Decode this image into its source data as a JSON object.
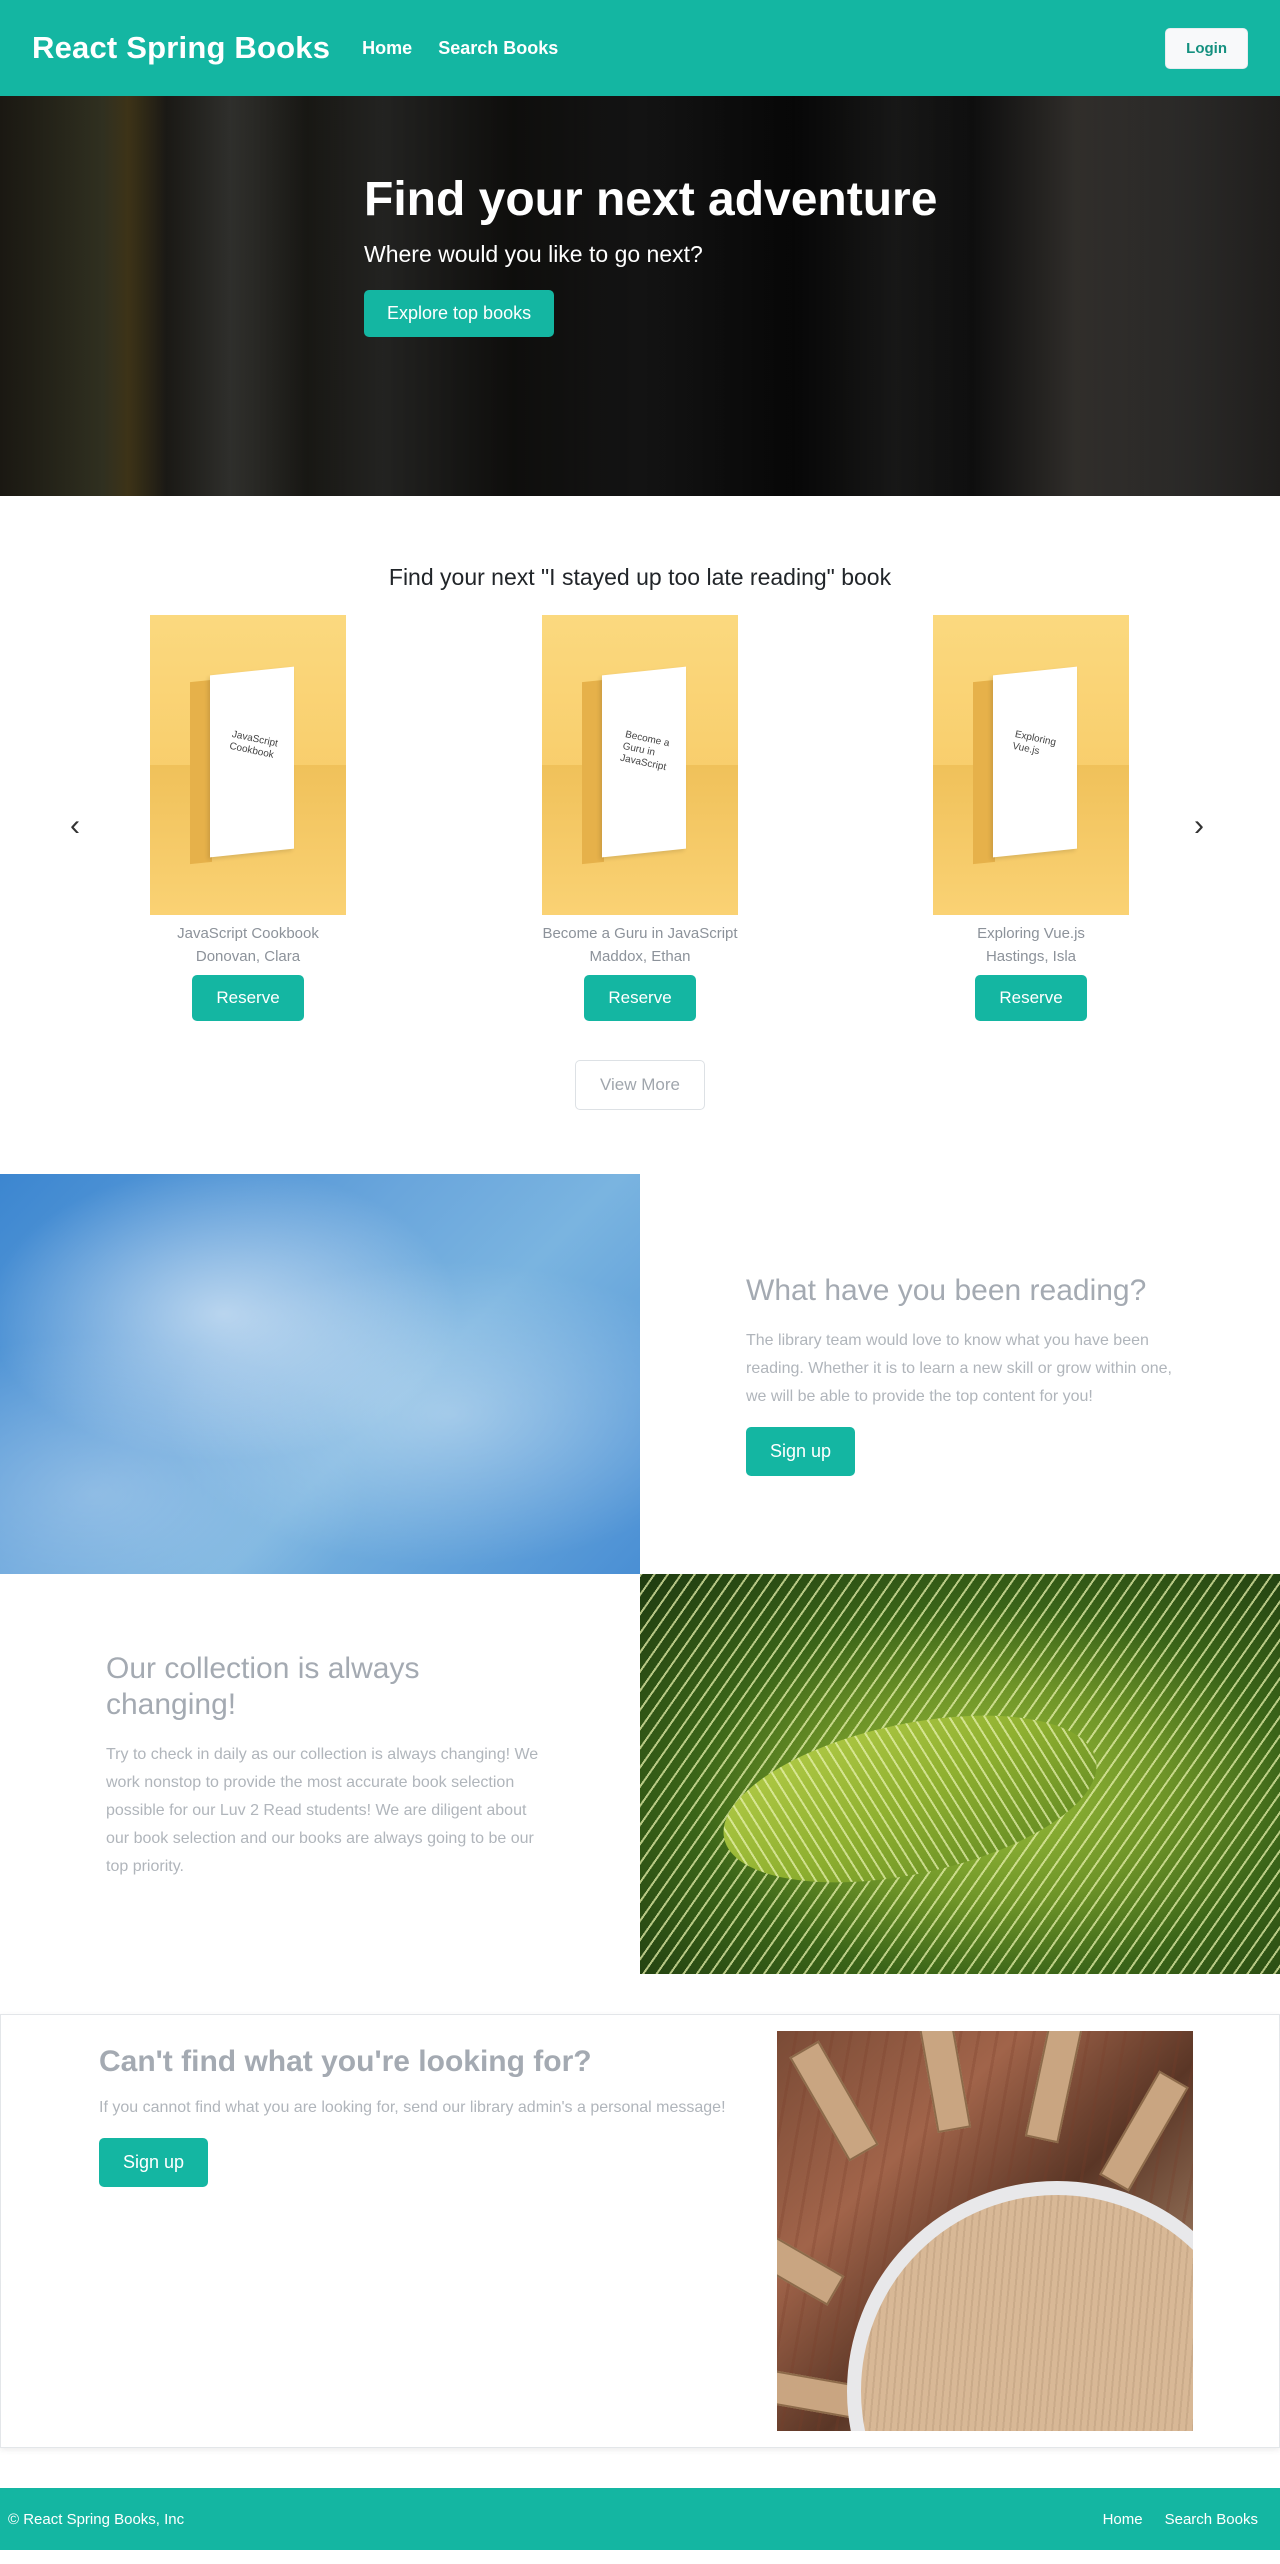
{
  "navbar": {
    "brand": "React Spring Books",
    "links": [
      "Home",
      "Search Books"
    ],
    "login_label": "Login"
  },
  "hero": {
    "title": "Find your next adventure",
    "subtitle": "Where would you like to go next?",
    "cta_label": "Explore top books"
  },
  "carousel": {
    "heading": "Find your next \"I stayed up too late reading\" book",
    "prev_glyph": "‹",
    "next_glyph": "›",
    "books": [
      {
        "cover_text": "JavaScript Cookbook",
        "title": "JavaScript Cookbook",
        "author": "Donovan, Clara",
        "action": "Reserve"
      },
      {
        "cover_text": "Become a Guru in JavaScript",
        "title": "Become a Guru in JavaScript",
        "author": "Maddox, Ethan",
        "action": "Reserve"
      },
      {
        "cover_text": "Exploring Vue.js",
        "title": "Exploring Vue.js",
        "author": "Hastings, Isla",
        "action": "Reserve"
      }
    ],
    "view_more_label": "View More"
  },
  "reading_section": {
    "title": "What have you been reading?",
    "text": "The library team would love to know what you have been reading. Whether it is to learn a new skill or grow within one, we will be able to provide the top content for you!",
    "button_label": "Sign up"
  },
  "collection_section": {
    "title": "Our collection is always changing!",
    "text": "Try to check in daily as our collection is always changing! We work nonstop to provide the most accurate book selection possible for our Luv 2 Read students! We are diligent about our book selection and our books are always going to be our top priority."
  },
  "contact_card": {
    "title": "Can't find what you're looking for?",
    "text": "If you cannot find what you are looking for, send our library admin's a personal message!",
    "button_label": "Sign up"
  },
  "footer": {
    "copyright": "© React Spring Books, Inc",
    "links": [
      "Home",
      "Search Books"
    ]
  },
  "colors": {
    "brand_teal": "#14b6a2",
    "muted_text": "#a4aab2"
  }
}
